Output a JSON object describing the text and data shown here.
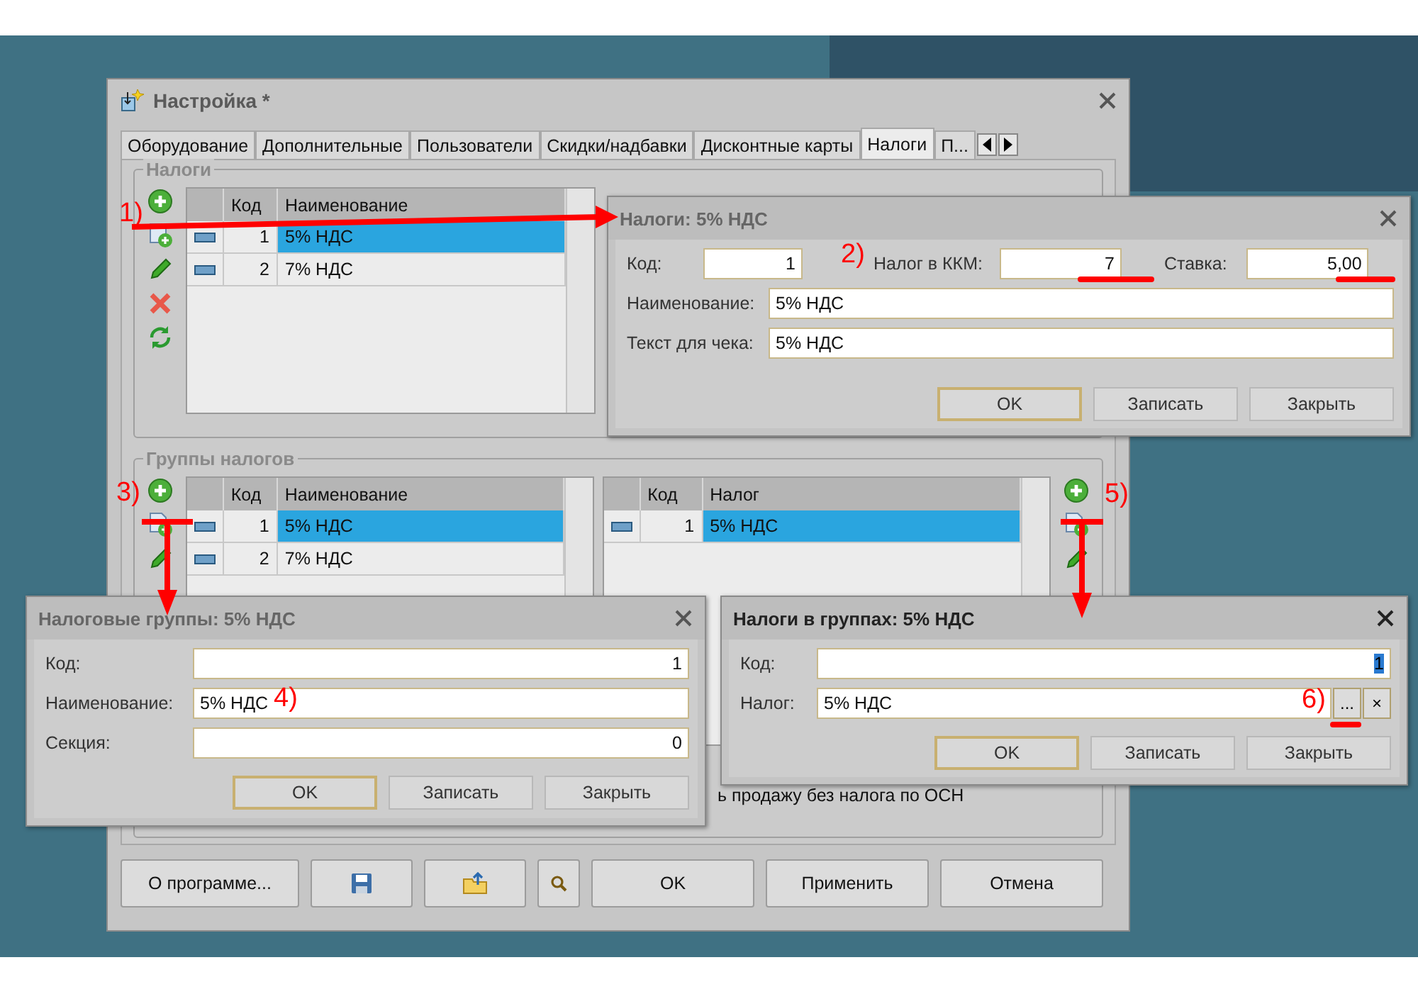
{
  "main_window": {
    "title": "Настройка *",
    "tabs": [
      {
        "label": "Оборудование",
        "selected": false
      },
      {
        "label": "Дополнительные",
        "selected": false
      },
      {
        "label": "Пользователи",
        "selected": false
      },
      {
        "label": "Скидки/надбавки",
        "selected": false
      },
      {
        "label": "Дисконтные карты",
        "selected": false
      },
      {
        "label": "Налоги",
        "selected": true
      },
      {
        "label": "П...",
        "selected": false
      }
    ],
    "taxes": {
      "legend": "Налоги",
      "tools": [
        {
          "kind": "add"
        },
        {
          "kind": "copy"
        },
        {
          "kind": "edit"
        },
        {
          "kind": "delete"
        },
        {
          "kind": "refresh"
        }
      ],
      "columns": [
        "Код",
        "Наименование"
      ],
      "rows": [
        {
          "code": "1",
          "name": "5% НДС",
          "selected": true
        },
        {
          "code": "2",
          "name": "7% НДС",
          "selected": false
        }
      ]
    },
    "tax_groups": {
      "legend": "Группы налогов",
      "tools": [
        {
          "kind": "add"
        },
        {
          "kind": "copy"
        },
        {
          "kind": "edit"
        }
      ],
      "columns": [
        "Код",
        "Наименование"
      ],
      "rows": [
        {
          "code": "1",
          "name": "5% НДС",
          "selected": true
        },
        {
          "code": "2",
          "name": "7% НДС",
          "selected": false
        }
      ],
      "right_columns": [
        "Код",
        "Налог"
      ],
      "right_rows": [
        {
          "code": "1",
          "name": "5% НДС",
          "selected": true
        }
      ],
      "right_tools": [
        {
          "kind": "add"
        },
        {
          "kind": "copy"
        },
        {
          "kind": "edit"
        }
      ]
    },
    "checkbox_text": "ь продажу без налога по ОСН",
    "buttons": [
      {
        "kind": "text",
        "label": "О программе..."
      },
      {
        "kind": "save"
      },
      {
        "kind": "export"
      },
      {
        "kind": "search"
      },
      {
        "kind": "text",
        "label": "OK"
      },
      {
        "kind": "text",
        "label": "Применить"
      },
      {
        "kind": "text",
        "label": "Отмена"
      }
    ]
  },
  "tax_dialog": {
    "title": "Налоги: 5% НДС",
    "code": {
      "label": "Код:",
      "value": "1"
    },
    "kkm": {
      "label": "Налог в ККМ:",
      "value": "7"
    },
    "rate": {
      "label": "Ставка:",
      "value": "5,00"
    },
    "name": {
      "label": "Наименование:",
      "value": "5% НДС"
    },
    "receipt": {
      "label": "Текст для чека:",
      "value": "5% НДС"
    },
    "buttons": [
      "OK",
      "Записать",
      "Закрыть"
    ]
  },
  "group_dialog": {
    "title": "Налоговые группы: 5% НДС",
    "fields": [
      {
        "label": "Код:",
        "value": "1",
        "kind": "number"
      },
      {
        "label": "Наименование:",
        "value": "5% НДС",
        "kind": "text"
      },
      {
        "label": "Секция:",
        "value": "0",
        "kind": "number"
      }
    ],
    "buttons": [
      "OK",
      "Записать",
      "Закрыть"
    ]
  },
  "group_tax_dialog": {
    "title": "Налоги в группах: 5% НДС",
    "code": {
      "label": "Код:",
      "value": "1",
      "selected": true
    },
    "tax": {
      "label": "Налог:",
      "value": "5% НДС",
      "choose": "...",
      "clear": "×"
    },
    "buttons": [
      "OK",
      "Записать",
      "Закрыть"
    ]
  },
  "annotations": [
    "1)",
    "2)",
    "3)",
    "4)",
    "5)",
    "6)"
  ]
}
